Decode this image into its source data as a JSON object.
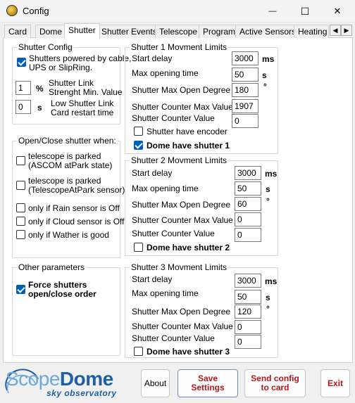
{
  "window": {
    "title": "Config",
    "minimize_glyph": "—",
    "maximize_glyph": "☐",
    "close_glyph": "✕"
  },
  "tabs": [
    {
      "label": "Card"
    },
    {
      "label": "Dome"
    },
    {
      "label": "Shutter"
    },
    {
      "label": "Shutter Events"
    },
    {
      "label": "Telescope"
    },
    {
      "label": "Program"
    },
    {
      "label": "Active Sensors"
    },
    {
      "label": "Heating"
    }
  ],
  "tab_scroll": {
    "left": "◀",
    "right": "▶"
  },
  "shutter_config": {
    "title": "Shutter Config",
    "powered_label_1": "Shutters powered by cable,",
    "powered_label_2": "UPS or SlipRing.",
    "powered_checked": true,
    "link_strength_value": "1",
    "link_strength_unit": "%",
    "link_strength_label_1": "Shutter Link",
    "link_strength_label_2": "Strenght Min. Value",
    "restart_value": "0",
    "restart_unit": "s",
    "restart_label_1": "Low Shutter Link",
    "restart_label_2": "Card restart time"
  },
  "open_close": {
    "title": "Open/Close shutter when:",
    "items": [
      {
        "line1": "telescope is parked",
        "line2": "(ASCOM atPark state)",
        "checked": false
      },
      {
        "line1": "telescope is parked",
        "line2": "(TelescopeAtPark sensor)",
        "checked": false
      },
      {
        "line1": "only if Rain sensor is Off",
        "checked": false
      },
      {
        "line1": "only if Cloud sensor is Off",
        "checked": false
      },
      {
        "line1": "only if Wather is good",
        "checked": false
      }
    ]
  },
  "other": {
    "title": "Other parameters",
    "force_label_1": "Force shutters",
    "force_label_2": "open/close order",
    "force_checked": true
  },
  "shutter1": {
    "title": "Shutter 1 Movment Limits",
    "start_delay_label": "Start delay",
    "start_delay_value": "3000",
    "start_delay_unit": "ms",
    "max_open_time_label": "Max opening time",
    "max_open_time_value": "50",
    "max_open_time_unit": "s",
    "max_open_degree_label": "Shutter Max Open Degree",
    "max_open_degree_value": "180",
    "degree_unit": "°",
    "counter_max_label": "Shutter Counter Max Value",
    "counter_max_value": "1907",
    "counter_value_label": "Shutter Counter Value",
    "counter_value": "0",
    "encoder_label": "Shutter have encoder",
    "encoder_checked": false,
    "dome_have_label": "Dome have shutter 1",
    "dome_have_checked": true
  },
  "shutter2": {
    "title": "Shutter 2 Movment Limits",
    "start_delay_label": "Start delay",
    "start_delay_value": "3000",
    "start_delay_unit": "ms",
    "max_open_time_label": "Max opening time",
    "max_open_time_value": "50",
    "max_open_time_unit": "s",
    "max_open_degree_label": "Shutter Max Open Degree",
    "max_open_degree_value": "60",
    "degree_unit": "°",
    "counter_max_label": "Shutter Counter Max Value",
    "counter_max_value": "0",
    "counter_value_label": "Shutter Counter Value",
    "counter_value": "0",
    "dome_have_label": "Dome have shutter 2",
    "dome_have_checked": false
  },
  "shutter3": {
    "title": "Shutter 3 Movment Limits",
    "start_delay_label": "Start delay",
    "start_delay_value": "3000",
    "start_delay_unit": "ms",
    "max_open_time_label": "Max opening time",
    "max_open_time_value": "50",
    "max_open_time_unit": "s",
    "max_open_degree_label": "Shutter Max Open Degree",
    "max_open_degree_value": "120",
    "degree_unit": "°",
    "counter_max_label": "Shutter Counter Max Value",
    "counter_max_value": "0",
    "counter_value_label": "Shutter Counter Value",
    "counter_value": "0",
    "dome_have_label": "Dome have shutter 3",
    "dome_have_checked": false
  },
  "buttons": {
    "about": "About",
    "save_1": "Save",
    "save_2": "Settings",
    "send_1": "Send config",
    "send_2": "to card",
    "exit": "Exit"
  },
  "logo": {
    "text_scope": "Scope",
    "text_dome": "Dome",
    "tagline": "sky observatory"
  },
  "colors": {
    "accent": "#005fb8",
    "button_text_red": "#b5161c",
    "logo_blue": "#1f5fa6"
  }
}
